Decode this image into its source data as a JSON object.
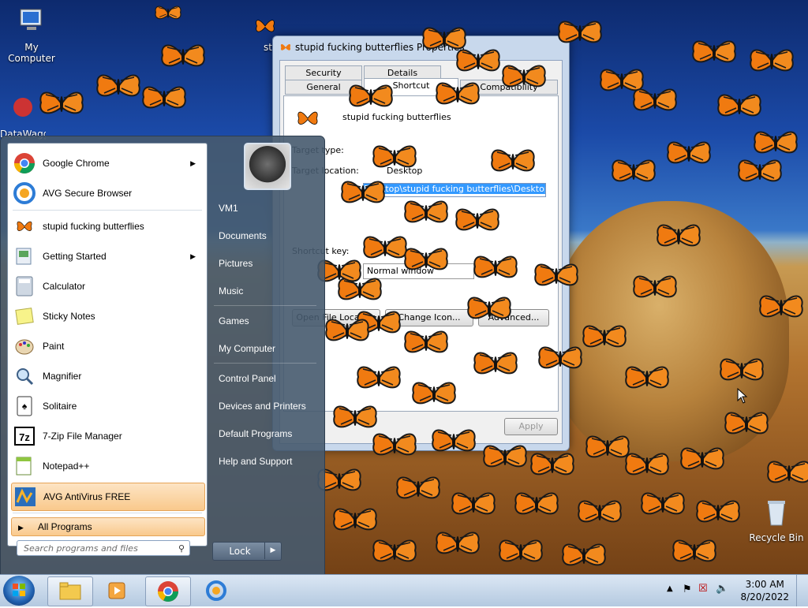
{
  "desktop": {
    "icons": [
      {
        "label": "My Computer"
      },
      {
        "label": "DataWagg"
      },
      {
        "label": "stupid fucking"
      },
      {
        "label": "Recycle Bin"
      }
    ]
  },
  "dialog": {
    "title": "stupid fucking butterflies Properties",
    "tabs": [
      "Security",
      "Details",
      "General",
      "Shortcut",
      "Compatibility"
    ],
    "shortcut_name": "stupid fucking butterflies",
    "target_type_label": "Target type:",
    "target_location_label": "Target location:",
    "target_location_value": "Desktop",
    "target_value": "Desktop\\stupid fucking butterflies\\Desktop.exe",
    "shortcut_key_label": "Shortcut key:",
    "run_value": "Normal window",
    "buttons": {
      "open_location": "Open File Location",
      "change_icon": "Change Icon...",
      "advanced": "Advanced...",
      "apply": "Apply"
    }
  },
  "start_menu": {
    "pinned": [
      {
        "label": "Google Chrome",
        "has_arrow": true
      },
      {
        "label": "AVG Secure Browser",
        "has_arrow": false
      }
    ],
    "recent": [
      {
        "label": "stupid fucking butterflies"
      },
      {
        "label": "Getting Started",
        "has_arrow": true
      },
      {
        "label": "Calculator"
      },
      {
        "label": "Sticky Notes"
      },
      {
        "label": "Paint"
      },
      {
        "label": "Magnifier"
      },
      {
        "label": "Solitaire"
      },
      {
        "label": "7-Zip File Manager"
      },
      {
        "label": "Notepad++"
      },
      {
        "label": "AVG AntiVirus FREE"
      }
    ],
    "all_programs": "All Programs",
    "search_placeholder": "Search programs and files",
    "right": [
      "VM1",
      "Documents",
      "Pictures",
      "Music",
      "Games",
      "My Computer",
      "Control Panel",
      "Devices and Printers",
      "Default Programs",
      "Help and Support"
    ],
    "lock_label": "Lock"
  },
  "taskbar": {
    "time": "3:00 AM",
    "date": "8/20/2022"
  },
  "colors": {
    "butterfly": "#f07a10",
    "highlight": "#f9c98c"
  }
}
